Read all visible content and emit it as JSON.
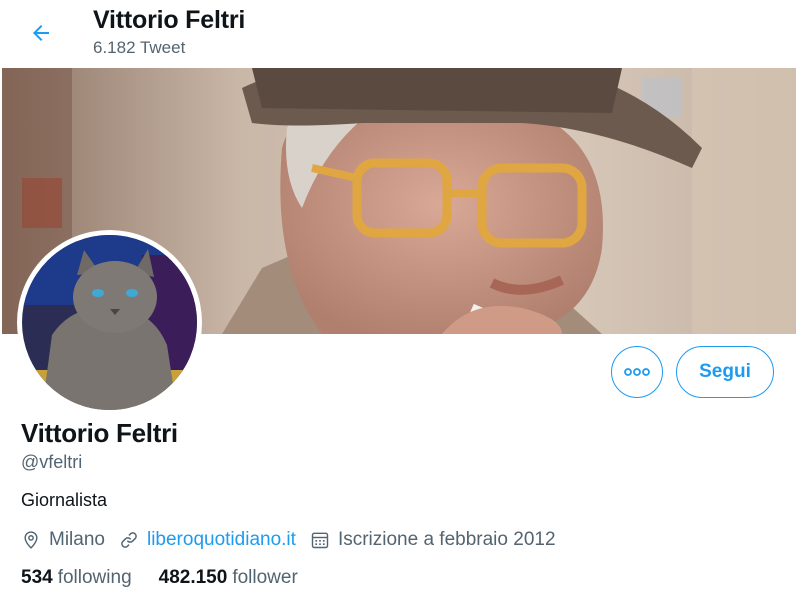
{
  "header": {
    "title": "Vittorio Feltri",
    "subtitle": "6.182 Tweet",
    "back_icon": "arrow-left-icon"
  },
  "profile": {
    "name": "Vittorio Feltri",
    "handle": "@vfeltri",
    "bio": "Giornalista",
    "location": "Milano",
    "website": "liberoquotidiano.it",
    "joined": "Iscrizione a febbraio 2012"
  },
  "actions": {
    "more_icon": "more-icon",
    "follow_label": "Segui"
  },
  "stats": {
    "following_count": "534",
    "following_label": "following",
    "followers_count": "482.150",
    "followers_label": "follower"
  },
  "colors": {
    "accent": "#1d9bf0",
    "text_primary": "#0f1419",
    "text_secondary": "#536471"
  }
}
